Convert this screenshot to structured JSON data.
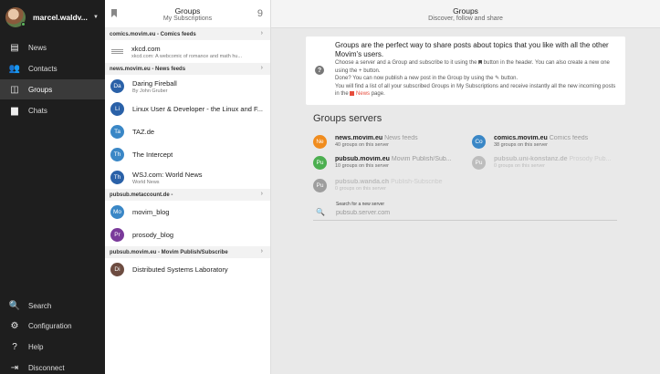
{
  "sidebar": {
    "user_name": "marcel.waldv...",
    "nav_top": [
      {
        "label": "News",
        "icon": "news-icon",
        "glyph": "▤"
      },
      {
        "label": "Contacts",
        "icon": "contacts-icon",
        "glyph": "👥"
      },
      {
        "label": "Groups",
        "icon": "groups-icon",
        "glyph": "◫",
        "active": true
      },
      {
        "label": "Chats",
        "icon": "chats-icon",
        "glyph": "▆"
      }
    ],
    "nav_bottom": [
      {
        "label": "Search",
        "icon": "search-icon",
        "glyph": "🔍"
      },
      {
        "label": "Configuration",
        "icon": "gear-icon",
        "glyph": "⚙"
      },
      {
        "label": "Help",
        "icon": "help-icon",
        "glyph": "?"
      },
      {
        "label": "Disconnect",
        "icon": "logout-icon",
        "glyph": "⇥"
      }
    ]
  },
  "list": {
    "title": "Groups",
    "subtitle": "My Subscriptions",
    "count": "9",
    "sections": [
      {
        "server": "comics.movim.eu - Comics feeds",
        "groups": [
          {
            "name": "xkcd.com",
            "desc": "xkcd.com: A webcomic of romance and math hu...",
            "avatar": "",
            "color": "",
            "rss": true
          }
        ]
      },
      {
        "server": "news.movim.eu - News feeds",
        "groups": [
          {
            "name": "Daring Fireball",
            "desc": "By John Gruber",
            "avatar": "Da",
            "color": "#2a61a8"
          },
          {
            "name": "Linux User & Developer - the Linux and F...",
            "desc": "",
            "avatar": "Li",
            "color": "#2a61a8"
          },
          {
            "name": "TAZ.de",
            "desc": "",
            "avatar": "Ta",
            "color": "#3a87c6"
          },
          {
            "name": "The Intercept",
            "desc": "",
            "avatar": "Th",
            "color": "#3a87c6"
          },
          {
            "name": "WSJ.com: World News",
            "desc": "World News",
            "avatar": "Th",
            "color": "#2a61a8"
          }
        ]
      },
      {
        "server": "pubsub.metaccount.de -",
        "groups": [
          {
            "name": "movim_blog",
            "desc": "",
            "avatar": "Mo",
            "color": "#3a87c6"
          },
          {
            "name": "prosody_blog",
            "desc": "",
            "avatar": "Pr",
            "color": "#7a3a9a"
          }
        ]
      },
      {
        "server": "pubsub.movim.eu - Movim Publish/Subscribe",
        "groups": [
          {
            "name": "Distributed Systems Laboratory",
            "desc": "",
            "avatar": "Di",
            "color": "#6d4c41"
          }
        ]
      }
    ]
  },
  "main": {
    "title": "Groups",
    "subtitle": "Discover, follow and share",
    "info": {
      "lead": "Groups are the perfect way to share posts about topics that you like with all the other Movim's users.",
      "line1a": "Choose a server and a Group and subscribe to it using the",
      "line1b": "button in the header. You can also create a new one using the + button.",
      "line2": "Done? You can now publish a new post in the Group by using the ✎ button.",
      "line3a": "You will find a list of all your subscribed Groups in My Subscriptions and receive instantly all the new incoming posts in the",
      "line3b": "News",
      "line3c": "page."
    },
    "servers_title": "Groups servers",
    "servers": [
      {
        "name": "news.movim.eu",
        "label": "News feeds",
        "count": "40 groups on this server",
        "avatar": "Ne",
        "color": "#f08c1e",
        "dim": false
      },
      {
        "name": "comics.movim.eu",
        "label": "Comics feeds",
        "count": "38 groups on this server",
        "avatar": "Co",
        "color": "#3a87c6",
        "dim": false
      },
      {
        "name": "pubsub.movim.eu",
        "label": "Movim Publish/Sub...",
        "count": "10 groups on this server",
        "avatar": "Pu",
        "color": "#4caf50",
        "dim": false
      },
      {
        "name": "pubsub.uni-konstanz.de",
        "label": "Prosody Pub...",
        "count": "0 groups on this server",
        "avatar": "Pu",
        "color": "#bdbdbd",
        "dim": true
      },
      {
        "name": "pubsub.wanda.ch",
        "label": "Publish-Subscribe",
        "count": "0 groups on this server",
        "avatar": "Pu",
        "color": "#9e9e9e",
        "dim": true
      }
    ],
    "search_label": "Search for a new server",
    "search_placeholder": "pubsub.server.com"
  }
}
